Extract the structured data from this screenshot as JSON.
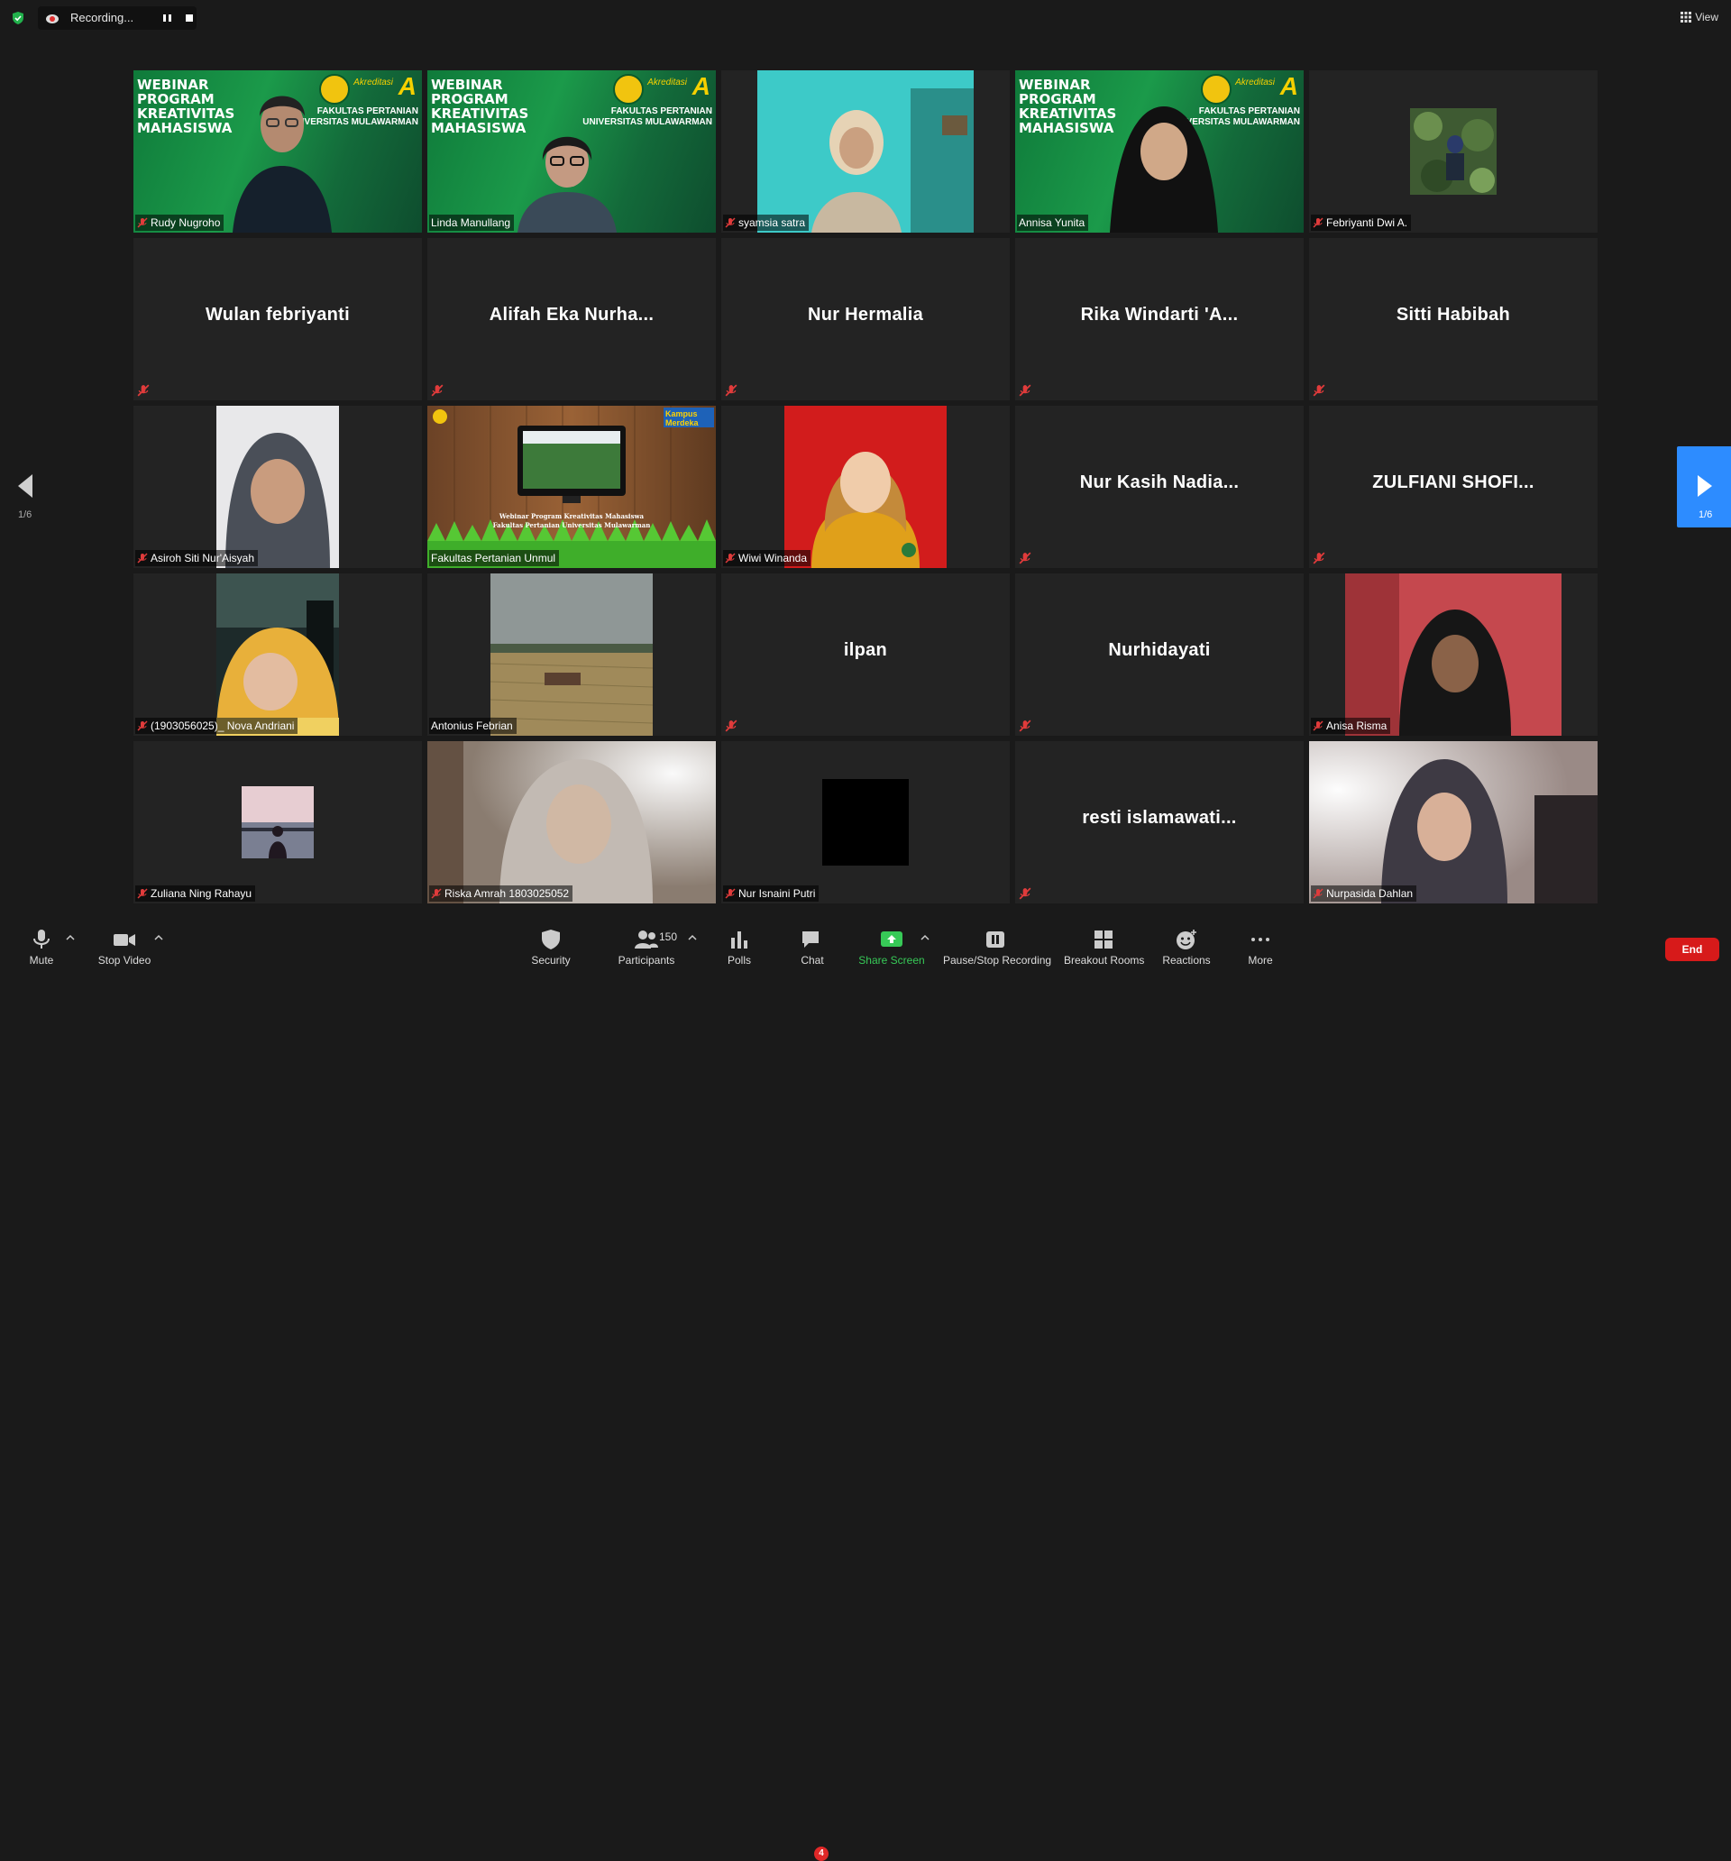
{
  "top": {
    "recording_text": "Recording...",
    "view_label": "View"
  },
  "pager": {
    "left": "1/6",
    "right": "1/6"
  },
  "tiles": [
    {
      "name": "Rudy Nugroho",
      "type": "video",
      "muted": true
    },
    {
      "name": "Linda Manullang",
      "type": "video",
      "muted": false
    },
    {
      "name": "syamsia satra",
      "type": "video",
      "muted": true
    },
    {
      "name": "Annisa Yunita",
      "type": "video",
      "muted": false,
      "active": true
    },
    {
      "name": "Febriyanti Dwi A.",
      "type": "video",
      "muted": true
    },
    {
      "name": "Wulan febriyanti",
      "type": "name",
      "muted": true
    },
    {
      "name": "Alifah Eka Nurha...",
      "type": "name",
      "muted": true
    },
    {
      "name": "Nur Hermalia",
      "type": "name",
      "muted": true
    },
    {
      "name": "Rika Windarti 'A...",
      "type": "name",
      "muted": true
    },
    {
      "name": "Sitti Habibah",
      "type": "name",
      "muted": true
    },
    {
      "name": "Asiroh Siti Nur'Aisyah",
      "type": "video",
      "muted": true
    },
    {
      "name": "Fakultas Pertanian Unmul",
      "type": "video",
      "muted": false
    },
    {
      "name": "Wiwi Winanda",
      "type": "video",
      "muted": true
    },
    {
      "name": "Nur Kasih Nadia...",
      "type": "name",
      "muted": true
    },
    {
      "name": "ZULFIANI SHOFI...",
      "type": "name",
      "muted": true
    },
    {
      "name": "(1903056025)_ Nova Andriani",
      "type": "video",
      "muted": true
    },
    {
      "name": "Antonius Febrian",
      "type": "video",
      "muted": false
    },
    {
      "name": "ilpan",
      "type": "name",
      "muted": true
    },
    {
      "name": "Nurhidayati",
      "type": "name",
      "muted": true
    },
    {
      "name": "Anisa Risma",
      "type": "video",
      "muted": true
    },
    {
      "name": "Zuliana Ning Rahayu",
      "type": "video",
      "muted": true
    },
    {
      "name": "Riska Amrah 1803025052",
      "type": "video",
      "muted": true
    },
    {
      "name": "Nur Isnaini Putri",
      "type": "video",
      "muted": true
    },
    {
      "name": "resti islamawati...",
      "type": "name",
      "muted": true
    },
    {
      "name": "Nurpasida Dahlan",
      "type": "video",
      "muted": true
    }
  ],
  "banner": {
    "left": "WEBINAR PROGRAM KREATIVITAS MAHASISWA",
    "right": "FAKULTAS PERTANIAN UNIVERSITAS MULAWARMAN",
    "accreditation": "Akreditasi",
    "grade": "A"
  },
  "slide": {
    "title": "Webinar Program Kreativitas Mahasiswa",
    "subtitle": "Fakultas Pertanian Universitas Mulawarman",
    "corner": "Kampus Merdeka"
  },
  "toolbar": {
    "mute": "Mute",
    "stop_video": "Stop Video",
    "security": "Security",
    "participants": "Participants",
    "participants_count": "150",
    "polls": "Polls",
    "chat": "Chat",
    "chat_badge": "4",
    "share_screen": "Share Screen",
    "pause_stop_recording": "Pause/Stop Recording",
    "breakout_rooms": "Breakout Rooms",
    "reactions": "Reactions",
    "more": "More",
    "end": "End"
  },
  "colors": {
    "accent": "#2d8cff",
    "active_speaker": "#d8e85a",
    "end": "#d71a1a",
    "share": "#37c957",
    "muted_icon": "#e03b3b"
  }
}
